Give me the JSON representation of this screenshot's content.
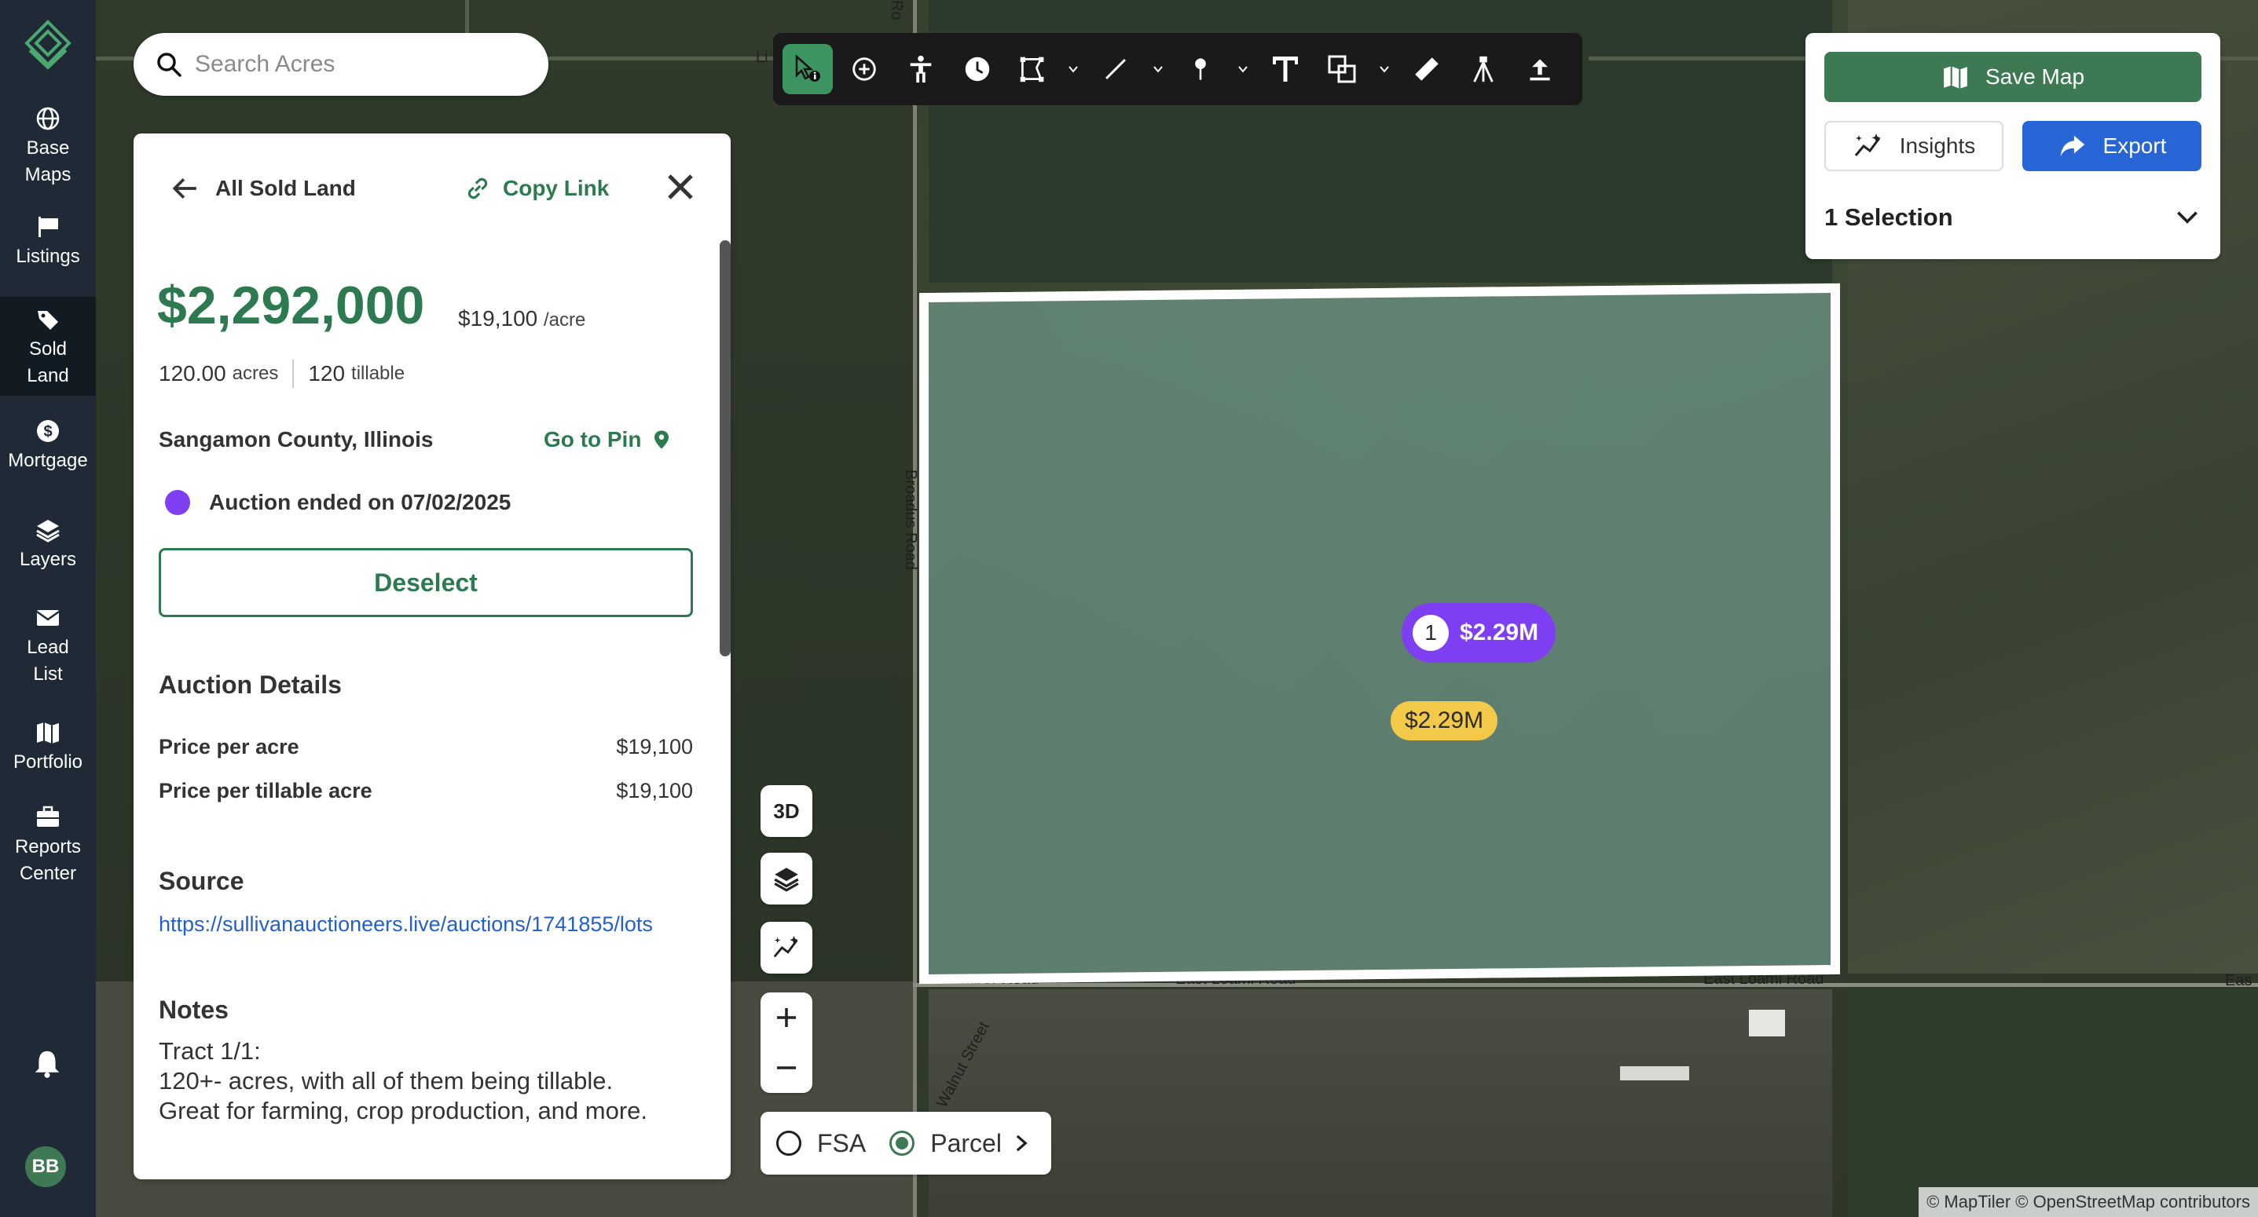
{
  "nav": {
    "items": [
      {
        "label": "Base Maps",
        "line1": "Base",
        "line2": "Maps"
      },
      {
        "label": "Listings",
        "line1": "Listings",
        "line2": ""
      },
      {
        "label": "Sold Land",
        "line1": "Sold",
        "line2": "Land"
      },
      {
        "label": "Mortgage",
        "line1": "Mortgage",
        "line2": ""
      },
      {
        "label": "Layers",
        "line1": "Layers",
        "line2": ""
      },
      {
        "label": "Lead List",
        "line1": "Lead",
        "line2": "List"
      },
      {
        "label": "Portfolio",
        "line1": "Portfolio",
        "line2": ""
      },
      {
        "label": "Reports Center",
        "line1": "Reports",
        "line2": "Center"
      }
    ],
    "active": "Sold Land",
    "avatar_initials": "BB",
    "accent_color": "#3d7a53",
    "bg_color": "#1f2a36"
  },
  "search": {
    "placeholder": "Search Acres",
    "value": ""
  },
  "panel": {
    "back_label": "All Sold Land",
    "copy_link_label": "Copy Link",
    "price": "$2,292,000",
    "price_per_acre": "$19,100",
    "price_per_acre_unit": "/acre",
    "acres_value": "120.00",
    "acres_unit": "acres",
    "tillable_value": "120",
    "tillable_unit": "tillable",
    "county": "Sangamon County, Illinois",
    "go_to_pin_label": "Go to Pin",
    "auction_status": "Auction ended on 07/02/2025",
    "deselect_label": "Deselect",
    "auction_details_title": "Auction Details",
    "details": [
      {
        "label": "Price per acre",
        "value": "$19,100"
      },
      {
        "label": "Price per tillable acre",
        "value": "$19,100"
      }
    ],
    "source_title": "Source",
    "source_url": "https://sullivanauctioneers.live/auctions/1741855/lots",
    "notes_title": "Notes",
    "notes_lines": [
      "Tract 1/1:",
      "120+- acres, with all of them being tillable.",
      "Great for farming, crop production, and more."
    ],
    "price_color": "#2e7a50",
    "status_color": "#7e3ff2"
  },
  "toolbar": {
    "icons": [
      "select-info-icon",
      "add-circle-icon",
      "person-icon",
      "clock-icon",
      "polygon-icon",
      "line-icon",
      "pin-icon",
      "text-icon",
      "shapes-icon",
      "ruler-icon",
      "survey-icon",
      "upload-icon"
    ]
  },
  "right_panel": {
    "save_label": "Save Map",
    "insights_label": "Insights",
    "export_label": "Export",
    "selection_label": "1 Selection",
    "export_color": "#2865d6"
  },
  "map": {
    "purple_pill_count": "1",
    "purple_pill_value": "$2.29M",
    "yellow_pill_value": "$2.29M",
    "roads": {
      "broadus": "Broadus Road",
      "top_road": "Ro",
      "left_top": "Li",
      "amber": "Amber Road",
      "east_loami_1": "East Loami Road",
      "east_loami_2": "East Loami Road",
      "east_edge": "Eas",
      "walnut": "Walnut Street"
    },
    "control_3d": "3D",
    "fsa_label": "FSA",
    "parcel_label": "Parcel",
    "attribution": "© MapTiler © OpenStreetMap contributors"
  }
}
